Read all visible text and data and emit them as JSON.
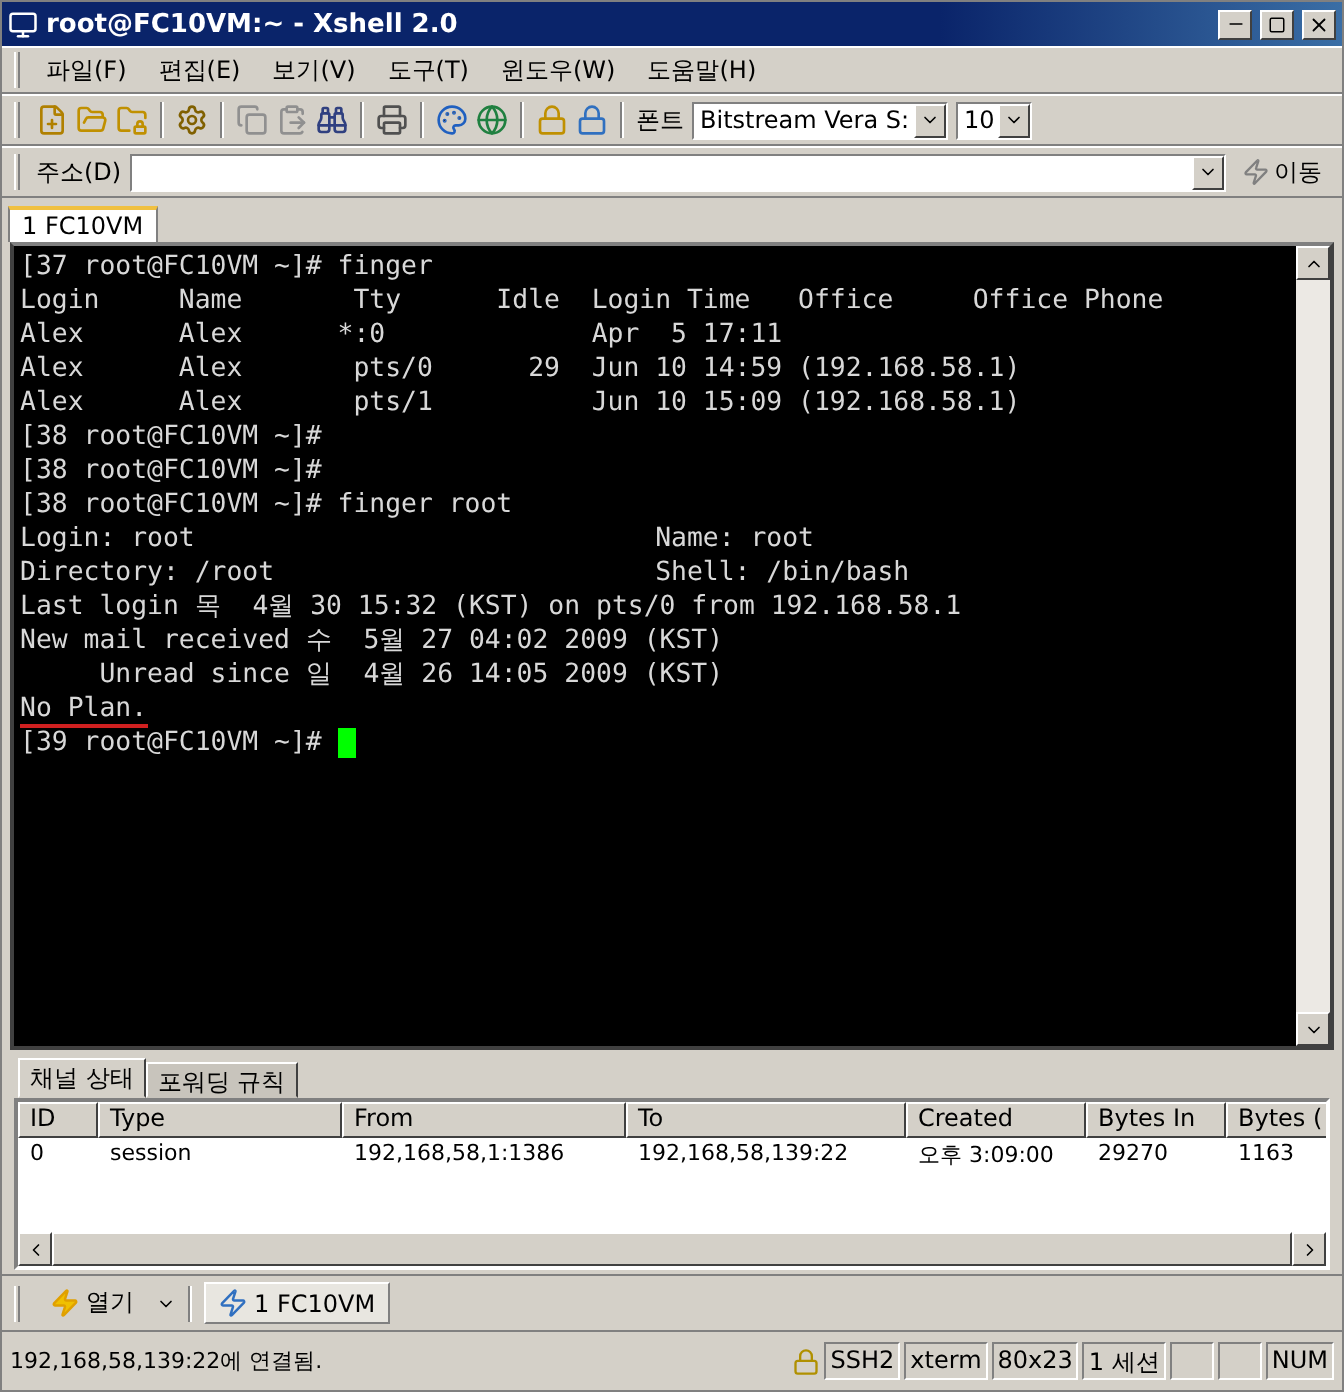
{
  "window": {
    "title": "root@FC10VM:~ - Xshell 2.0"
  },
  "menu": [
    "파일(F)",
    "편집(E)",
    "보기(V)",
    "도구(T)",
    "윈도우(W)",
    "도움말(H)"
  ],
  "toolbar": {
    "font_label": "폰트",
    "font_value": "Bitstream Vera S:",
    "size_value": "10"
  },
  "address": {
    "label": "주소(D)",
    "go": "이동"
  },
  "tabs": [
    {
      "label": "1 FC10VM",
      "selected": true
    }
  ],
  "terminal": {
    "cursor": true,
    "lines": [
      {
        "text": "[37 root@FC10VM ~]# finger",
        "underlined": false
      },
      {
        "text": "Login     Name       Tty      Idle  Login Time   Office     Office Phone",
        "underlined": false
      },
      {
        "text": "Alex      Alex      *:0             Apr  5 17:11",
        "underlined": false
      },
      {
        "text": "Alex      Alex       pts/0      29  Jun 10 14:59 (192.168.58.1)",
        "underlined": false
      },
      {
        "text": "Alex      Alex       pts/1          Jun 10 15:09 (192.168.58.1)",
        "underlined": false
      },
      {
        "text": "[38 root@FC10VM ~]#",
        "underlined": false
      },
      {
        "text": "[38 root@FC10VM ~]#",
        "underlined": false
      },
      {
        "text": "[38 root@FC10VM ~]# finger root",
        "underlined": false
      },
      {
        "text": "Login: root                             Name: root",
        "underlined": false
      },
      {
        "text": "Directory: /root                        Shell: /bin/bash",
        "underlined": false
      },
      {
        "text": "Last login 목  4월 30 15:32 (KST) on pts/0 from 192.168.58.1",
        "underlined": false
      },
      {
        "text": "New mail received 수  5월 27 04:02 2009 (KST)",
        "underlined": false
      },
      {
        "text": "     Unread since 일  4월 26 14:05 2009 (KST)",
        "underlined": false
      },
      {
        "text": "No Plan.",
        "underlined": true
      },
      {
        "text": "[39 root@FC10VM ~]# ",
        "underlined": false
      }
    ]
  },
  "panel_tabs": [
    {
      "label": "채널 상태",
      "selected": true
    },
    {
      "label": "포워딩 규칙",
      "selected": false
    }
  ],
  "table": {
    "columns": [
      "ID",
      "Type",
      "From",
      "To",
      "Created",
      "Bytes In",
      "Bytes ("
    ],
    "rows": [
      [
        "0",
        "session",
        "192,168,58,1:1386",
        "192,168,58,139:22",
        "오후 3:09:00",
        "29270",
        "1163"
      ]
    ]
  },
  "taskbar": {
    "open_label": "열기",
    "sessions": [
      {
        "label": "1 FC10VM",
        "selected": true
      }
    ]
  },
  "status_bar": {
    "message": "192,168,58,139:22에 연결됨.",
    "cells": [
      "SSH2",
      "xterm",
      "80x23",
      "1 세션",
      "",
      "",
      "NUM"
    ]
  }
}
